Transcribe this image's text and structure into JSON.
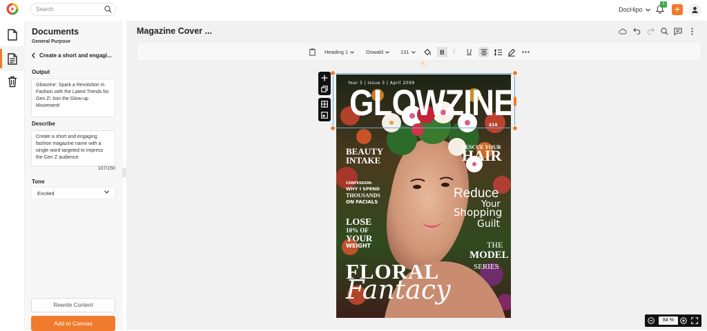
{
  "topbar": {
    "search_placeholder": "Search",
    "account_name": "DocHipo",
    "notification_count": "1"
  },
  "panel": {
    "title": "Documents",
    "subtitle": "General Purpose",
    "back_label": "Create a short and engagi...",
    "output_label": "Output",
    "output_text": "Glowzine: Spark a Revolution in Fashion with the Latest Trends for Gen Z! Join the Glow-up Movement!",
    "describe_label": "Describe",
    "describe_text": "Create a short and engaging fashion magazine name with a single word targeted to impress the Gen Z audience",
    "char_count": "107/150",
    "tone_label": "Tone",
    "tone_value": "Excited",
    "rewrite_label": "Rewrite Content",
    "add_label": "Add to Canvas"
  },
  "editor": {
    "doc_title": "Magazine Cover ...",
    "heading_style": "Heading 1",
    "font_name": "Oswald",
    "font_size": "131",
    "zoom_value": "84",
    "zoom_unit": "%"
  },
  "magazine": {
    "issue_line": "Year 5 | Issue 3 | April 2099",
    "masthead": "GLOWZINE",
    "price": "$16",
    "beauty": "BEAUTY",
    "intake": "INTAKE",
    "rescue": "RESCUE YOUR",
    "hair": "HAIR",
    "confession": "CONFESSION:",
    "why_spend": "WHY I SPEND",
    "thousands": "THOUSANDS",
    "on_facials": "ON FACIALS",
    "reduce": "Reduce",
    "your": "Your",
    "shopping": "Shopping",
    "guilt": "Guilt",
    "lose": "LOSE",
    "pct": "10% OF",
    "your2": "YOUR",
    "weight": "WEIGHT",
    "the": "THE",
    "model": "MODEL",
    "series": "SERIES",
    "floral": "FLORAL",
    "fantasy": "Fantacy"
  },
  "colors": {
    "accent": "#f07b2c",
    "badge": "#3aa94b",
    "selection": "#6ea8d8"
  }
}
